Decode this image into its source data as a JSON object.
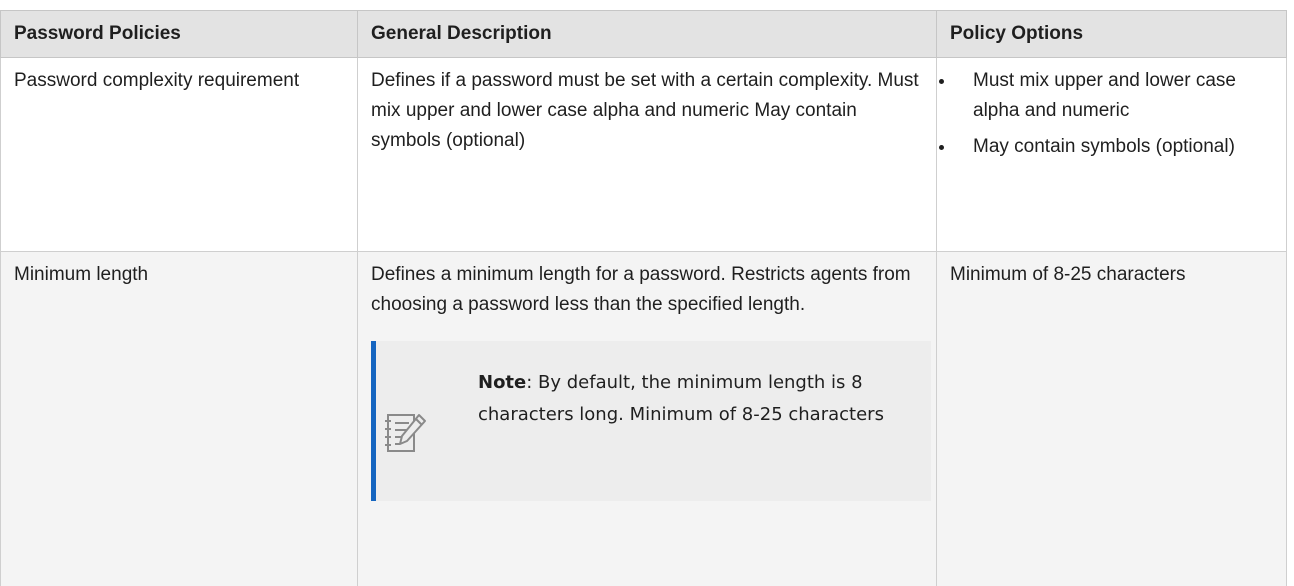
{
  "table": {
    "headers": [
      "Password Policies",
      "General Description",
      "Policy Options"
    ],
    "rows": [
      {
        "policy": "Password complexity requirement",
        "description": "Defines if a password must be set with a certain complexity. Must mix upper and lower case alpha and numeric May contain symbols (optional)",
        "options": [
          "Must mix upper and lower case alpha and numeric",
          "May contain symbols (optional)"
        ]
      },
      {
        "policy": "Minimum length",
        "description": "Defines a minimum length for a password. Restricts agents from choosing a password less than the specified length.",
        "note": {
          "label": "Note",
          "text": ": By default, the minimum length is 8 characters long. Minimum of 8-25 characters",
          "icon": "note-edit-icon"
        },
        "options_text": "Minimum of 8-25 characters"
      }
    ]
  },
  "colors": {
    "header_bg": "#e3e3e3",
    "row_alt_bg": "#f4f4f4",
    "note_bg": "#ededed",
    "note_accent": "#1565c0"
  }
}
